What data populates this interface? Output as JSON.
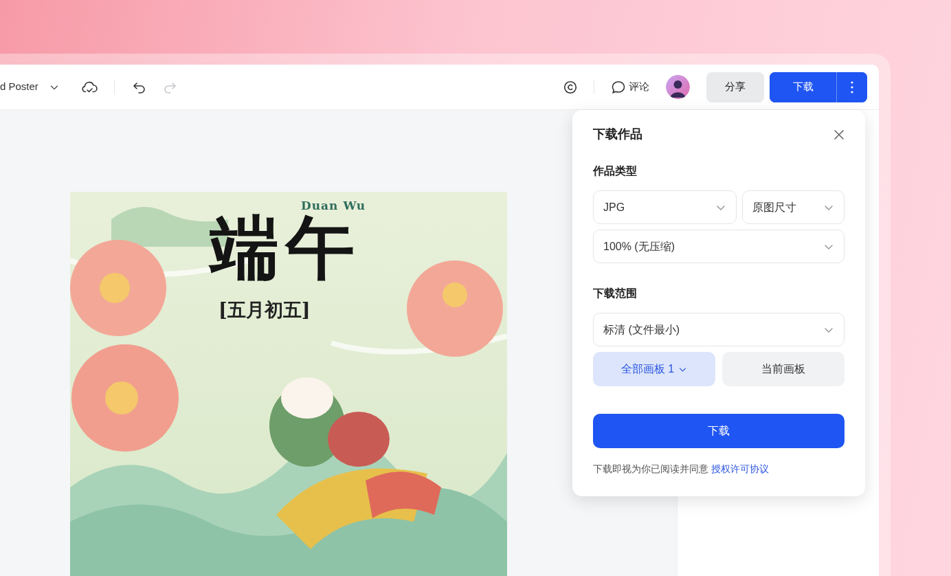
{
  "document": {
    "title": "d Poster"
  },
  "history": [
    {
      "kind": "undo",
      "disabled": false
    },
    {
      "kind": "redo",
      "disabled": true
    }
  ],
  "comment_label": "评论",
  "share_button": "分享",
  "download_button": "下载",
  "poster": {
    "subtitle": "Duan Wu",
    "title": "端午",
    "date": "[五月初五]"
  },
  "dialog": {
    "title": "下载作品",
    "type_label": "作品类型",
    "format": "JPG",
    "size": "原图尺寸",
    "quality": "100% (无压缩)",
    "range_label": "下载范围",
    "resolution": "标清 (文件最小)",
    "scope_options": [
      {
        "label": "全部画板 1",
        "selected": true,
        "has_menu": true
      },
      {
        "label": "当前画板",
        "selected": false,
        "has_menu": false
      }
    ],
    "submit": "下载",
    "agreement": "下载即视为你已阅读并同意",
    "agreement_link": "授权许可协议"
  }
}
